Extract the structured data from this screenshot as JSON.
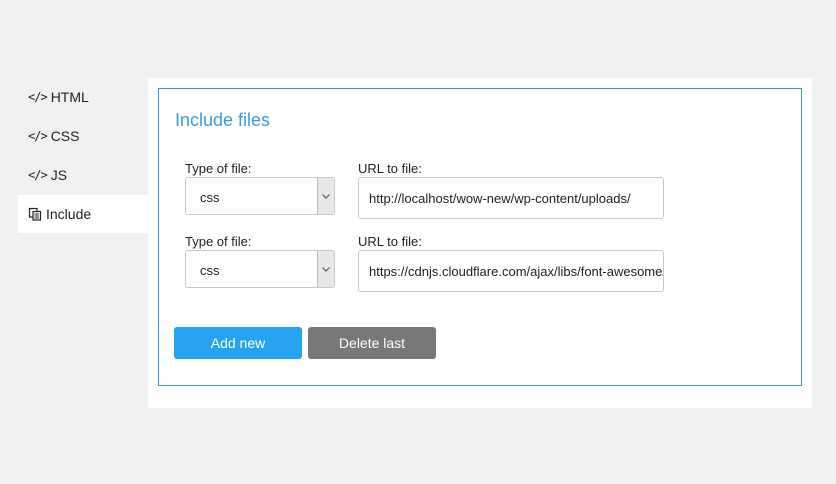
{
  "tabs": [
    {
      "label": "HTML",
      "icon": "code-icon"
    },
    {
      "label": "CSS",
      "icon": "code-icon"
    },
    {
      "label": "JS",
      "icon": "code-icon"
    },
    {
      "label": "Include",
      "icon": "copy-icon",
      "active": true
    }
  ],
  "panel": {
    "title": "Include files",
    "rows": [
      {
        "type_label": "Type of file:",
        "type_value": "css",
        "url_label": "URL to file:",
        "url_value": "http://localhost/wow-new/wp-content/uploads/"
      },
      {
        "type_label": "Type of file:",
        "type_value": "css",
        "url_label": "URL to file:",
        "url_value": "https://cdnjs.cloudflare.com/ajax/libs/font-awesome/"
      }
    ],
    "add_label": "Add new",
    "delete_label": "Delete last"
  },
  "colors": {
    "accent": "#2f98e3",
    "add_button": "#26a4f2",
    "delete_button": "#787878",
    "background": "#f1f1f1"
  }
}
